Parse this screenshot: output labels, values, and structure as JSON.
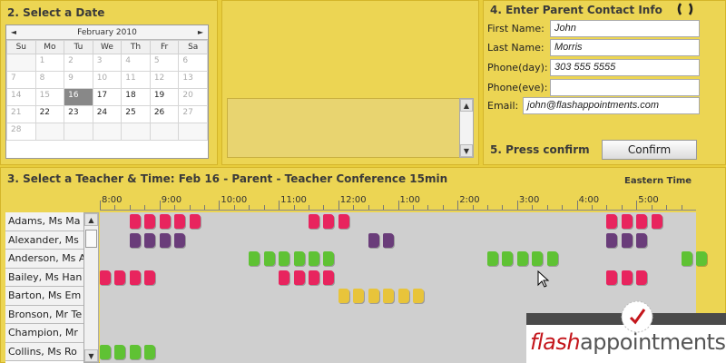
{
  "section2": {
    "title": "2. Select a Date"
  },
  "calendar": {
    "prev": "◄",
    "next": "►",
    "month": "February 2010",
    "weekdays": [
      "Su",
      "Mo",
      "Tu",
      "We",
      "Th",
      "Fr",
      "Sa"
    ],
    "weeks": [
      [
        {
          "d": "",
          "s": "empty"
        },
        {
          "d": "1",
          "s": "past"
        },
        {
          "d": "2",
          "s": "past"
        },
        {
          "d": "3",
          "s": "past"
        },
        {
          "d": "4",
          "s": "past"
        },
        {
          "d": "5",
          "s": "past"
        },
        {
          "d": "6",
          "s": "past"
        }
      ],
      [
        {
          "d": "7",
          "s": "past"
        },
        {
          "d": "8",
          "s": "past"
        },
        {
          "d": "9",
          "s": "past"
        },
        {
          "d": "10",
          "s": "past"
        },
        {
          "d": "11",
          "s": "past"
        },
        {
          "d": "12",
          "s": "past"
        },
        {
          "d": "13",
          "s": "past"
        }
      ],
      [
        {
          "d": "14",
          "s": "past"
        },
        {
          "d": "15",
          "s": "past"
        },
        {
          "d": "16",
          "s": "sel"
        },
        {
          "d": "17",
          "s": ""
        },
        {
          "d": "18",
          "s": ""
        },
        {
          "d": "19",
          "s": ""
        },
        {
          "d": "20",
          "s": "past"
        }
      ],
      [
        {
          "d": "21",
          "s": "past"
        },
        {
          "d": "22",
          "s": ""
        },
        {
          "d": "23",
          "s": ""
        },
        {
          "d": "24",
          "s": ""
        },
        {
          "d": "25",
          "s": ""
        },
        {
          "d": "26",
          "s": ""
        },
        {
          "d": "27",
          "s": "past"
        }
      ],
      [
        {
          "d": "28",
          "s": "past"
        },
        {
          "d": "",
          "s": "empty"
        },
        {
          "d": "",
          "s": "empty"
        },
        {
          "d": "",
          "s": "empty"
        },
        {
          "d": "",
          "s": "empty"
        },
        {
          "d": "",
          "s": "empty"
        },
        {
          "d": "",
          "s": "empty"
        }
      ]
    ]
  },
  "section4": {
    "title": "4. Enter Parent Contact Info",
    "fields": [
      {
        "label": "First Name:",
        "value": "John"
      },
      {
        "label": "Last Name:",
        "value": "Morris"
      },
      {
        "label": "Phone(day):",
        "value": "303 555 5555"
      },
      {
        "label": "Phone(eve):",
        "value": ""
      },
      {
        "label": "Email:",
        "value": "john@flashappointments.com"
      }
    ]
  },
  "section5": {
    "title": "5. Press confirm",
    "button": "Confirm"
  },
  "section3": {
    "title": "3. Select a Teacher & Time: Feb 16 - Parent - Teacher Conference 15min",
    "timezone": "Eastern Time",
    "times": [
      "8:00",
      "9:00",
      "10:00",
      "11:00",
      "12:00",
      "1:00",
      "2:00",
      "3:00",
      "4:00",
      "5:00"
    ],
    "teachers": [
      "Adams, Ms Ma",
      "Alexander, Ms",
      "Anderson, Ms A",
      "Bailey, Ms Han",
      "Barton, Ms Em",
      "Bronson, Mr Te",
      "Champion, Mr",
      "Collins, Ms Ro"
    ],
    "colors": {
      "pink": "#e8245e",
      "purple": "#6a3d7a",
      "green": "#5fc234",
      "yellow": "#e8c43a"
    },
    "slots": [
      {
        "row": 0,
        "color": "pink",
        "start": 0.5,
        "count": 5
      },
      {
        "row": 0,
        "color": "pink",
        "start": 3.5,
        "count": 3
      },
      {
        "row": 0,
        "color": "pink",
        "start": 8.5,
        "count": 4
      },
      {
        "row": 1,
        "color": "purple",
        "start": 0.5,
        "count": 4
      },
      {
        "row": 1,
        "color": "purple",
        "start": 4.5,
        "count": 2
      },
      {
        "row": 1,
        "color": "purple",
        "start": 8.5,
        "count": 3
      },
      {
        "row": 2,
        "color": "green",
        "start": 2.5,
        "count": 6
      },
      {
        "row": 2,
        "color": "green",
        "start": 6.5,
        "count": 5
      },
      {
        "row": 2,
        "color": "green",
        "start": 9.75,
        "count": 2
      },
      {
        "row": 3,
        "color": "pink",
        "start": 0,
        "count": 4
      },
      {
        "row": 3,
        "color": "pink",
        "start": 3,
        "count": 4
      },
      {
        "row": 3,
        "color": "pink",
        "start": 8.5,
        "count": 3
      },
      {
        "row": 4,
        "color": "yellow",
        "start": 4,
        "count": 6
      },
      {
        "row": 7,
        "color": "green",
        "start": 0,
        "count": 4
      }
    ]
  },
  "logo": {
    "part1": "flash",
    "part2": "appointments"
  }
}
